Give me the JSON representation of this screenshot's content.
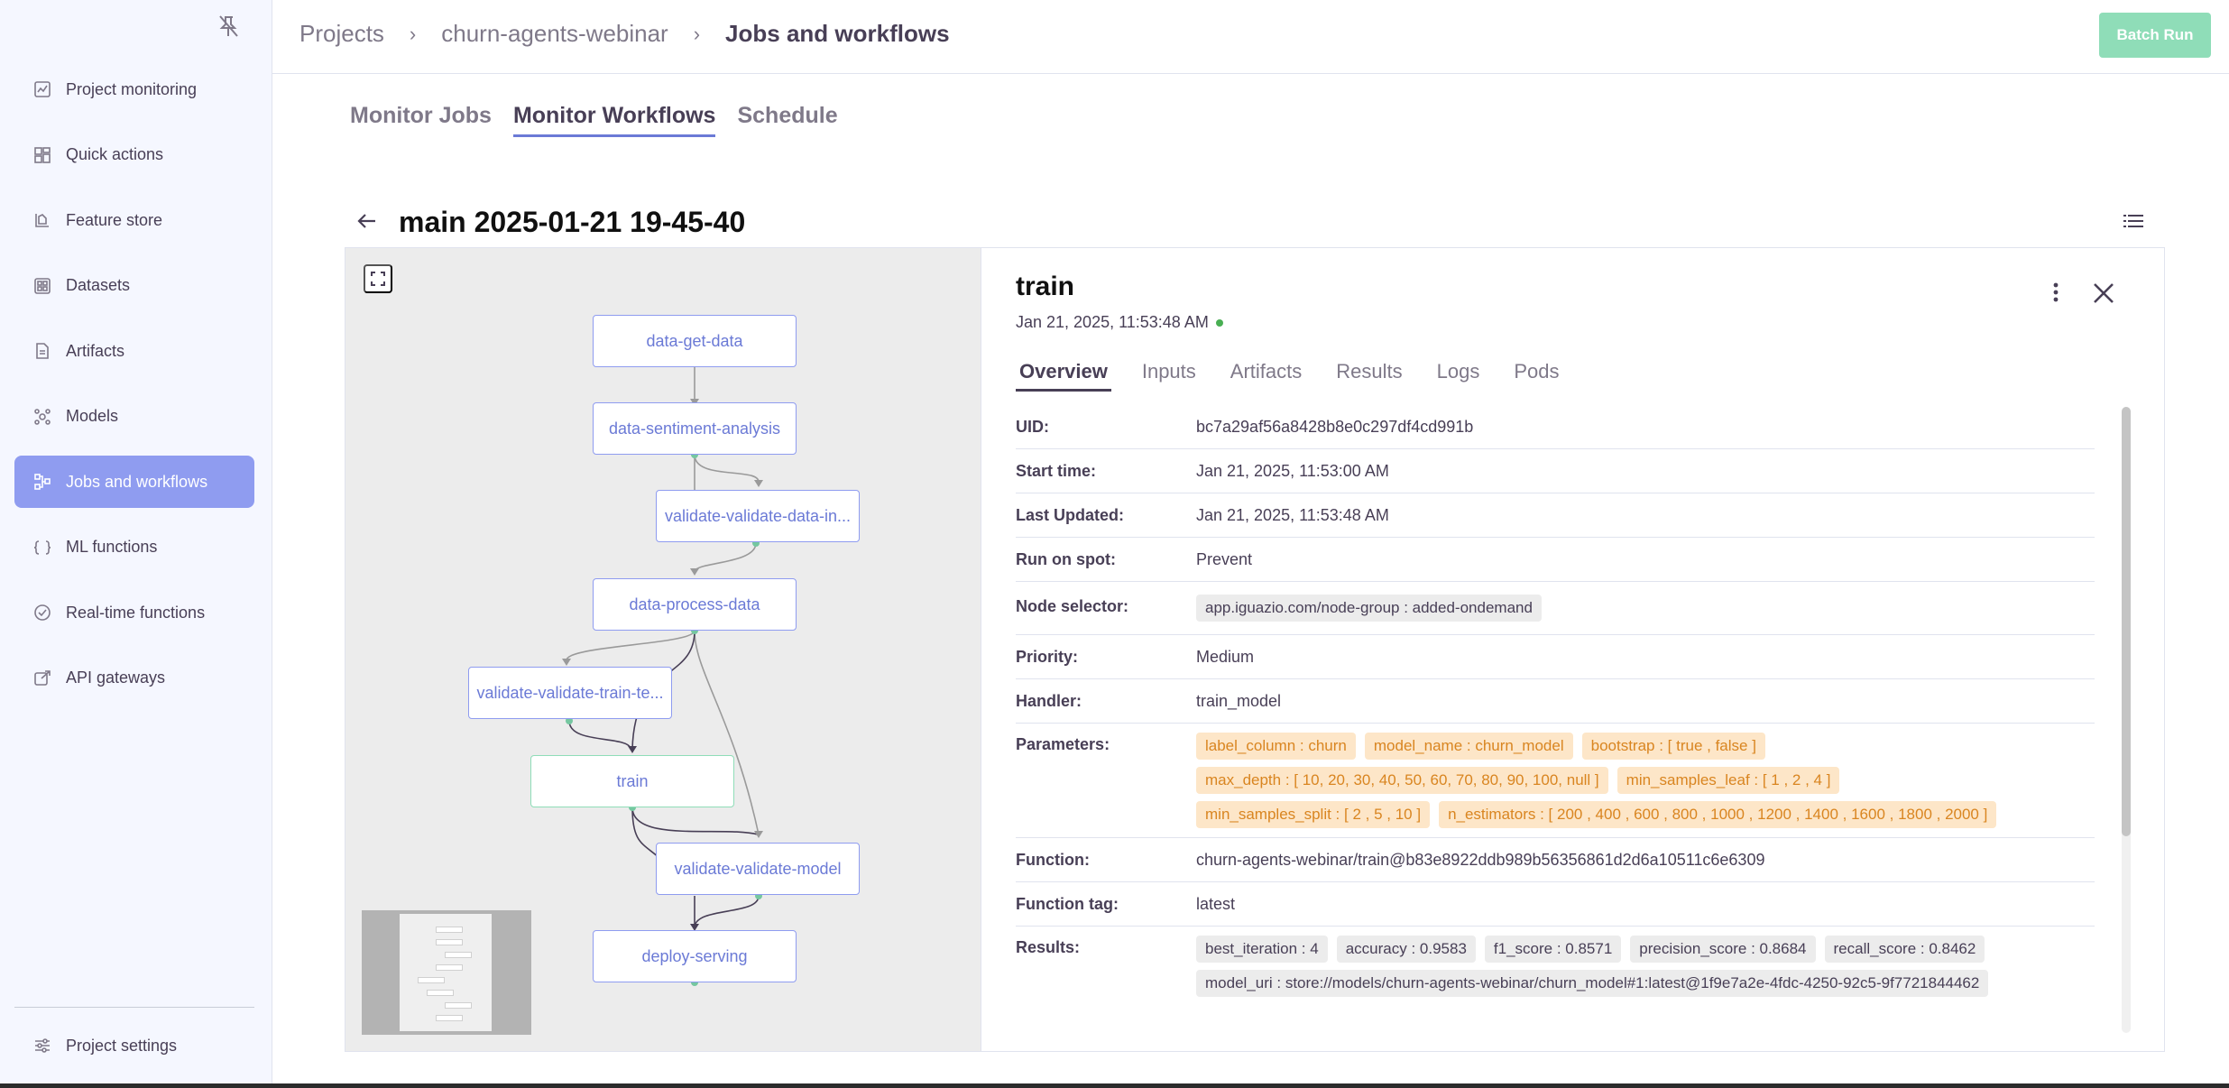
{
  "sidebar": {
    "items": [
      {
        "label": "Project monitoring",
        "icon": "monitoring-icon"
      },
      {
        "label": "Quick actions",
        "icon": "quick-actions-icon"
      },
      {
        "label": "Feature store",
        "icon": "feature-store-icon"
      },
      {
        "label": "Datasets",
        "icon": "datasets-icon"
      },
      {
        "label": "Artifacts",
        "icon": "artifacts-icon"
      },
      {
        "label": "Models",
        "icon": "models-icon"
      },
      {
        "label": "Jobs and workflows",
        "icon": "jobs-icon",
        "active": true
      },
      {
        "label": "ML functions",
        "icon": "ml-functions-icon"
      },
      {
        "label": "Real-time functions",
        "icon": "realtime-functions-icon"
      },
      {
        "label": "API gateways",
        "icon": "api-gateways-icon"
      }
    ],
    "settings_label": "Project settings"
  },
  "header": {
    "breadcrumbs": [
      "Projects",
      "churn-agents-webinar",
      "Jobs and workflows"
    ],
    "batch_run_label": "Batch Run"
  },
  "tabs": [
    "Monitor Jobs",
    "Monitor Workflows",
    "Schedule"
  ],
  "active_tab": "Monitor Workflows",
  "workflow": {
    "title": "main 2025-01-21 19-45-40",
    "nodes": [
      {
        "label": "data-get-data"
      },
      {
        "label": "data-sentiment-analysis"
      },
      {
        "label": "validate-validate-data-in..."
      },
      {
        "label": "data-process-data"
      },
      {
        "label": "validate-validate-train-te..."
      },
      {
        "label": "train",
        "selected": true
      },
      {
        "label": "validate-validate-model"
      },
      {
        "label": "deploy-serving"
      }
    ]
  },
  "details": {
    "title": "train",
    "date": "Jan 21, 2025, 11:53:48 AM",
    "status_color": "#49af53",
    "tabs": [
      "Overview",
      "Inputs",
      "Artifacts",
      "Results",
      "Logs",
      "Pods"
    ],
    "rows": {
      "uid": {
        "label": "UID:",
        "value": "bc7a29af56a8428b8e0c297df4cd991b"
      },
      "start_time": {
        "label": "Start time:",
        "value": "Jan 21, 2025, 11:53:00 AM"
      },
      "last_updated": {
        "label": "Last Updated:",
        "value": "Jan 21, 2025, 11:53:48 AM"
      },
      "run_on_spot": {
        "label": "Run on spot:",
        "value": "Prevent"
      },
      "node_selector": {
        "label": "Node selector:",
        "value": "app.iguazio.com/node-group : added-ondemand"
      },
      "priority": {
        "label": "Priority:",
        "value": "Medium"
      },
      "handler": {
        "label": "Handler:",
        "value": "train_model"
      },
      "parameters": {
        "label": "Parameters:",
        "values": [
          "label_column : churn",
          "model_name : churn_model",
          "bootstrap : [ true , false ]",
          "max_depth : [ 10, 20, 30, 40, 50, 60, 70, 80, 90, 100, null ]",
          "min_samples_leaf : [ 1 , 2 , 4 ]",
          "min_samples_split : [ 2 , 5 , 10 ]",
          "n_estimators : [ 200 , 400 , 600 , 800 , 1000 , 1200 , 1400 , 1600 , 1800 , 2000 ]"
        ]
      },
      "function": {
        "label": "Function:",
        "value": "churn-agents-webinar/train@b83e8922ddb989b56356861d2d6a10511c6e6309"
      },
      "function_tag": {
        "label": "Function tag:",
        "value": "latest"
      },
      "results": {
        "label": "Results:",
        "values": [
          "best_iteration : 4",
          "accuracy : 0.9583",
          "f1_score : 0.8571",
          "precision_score : 0.8684",
          "recall_score : 0.8462",
          "model_uri : store://models/churn-agents-webinar/churn_model#1:latest@1f9e7a2e-4fdc-4250-92c5-9f7721844462"
        ]
      }
    }
  },
  "colors": {
    "accent": "#8f9cf0",
    "batch_run": "#8fddb8",
    "param_chip_bg": "#fde6c8",
    "param_chip_text": "#d98520"
  }
}
